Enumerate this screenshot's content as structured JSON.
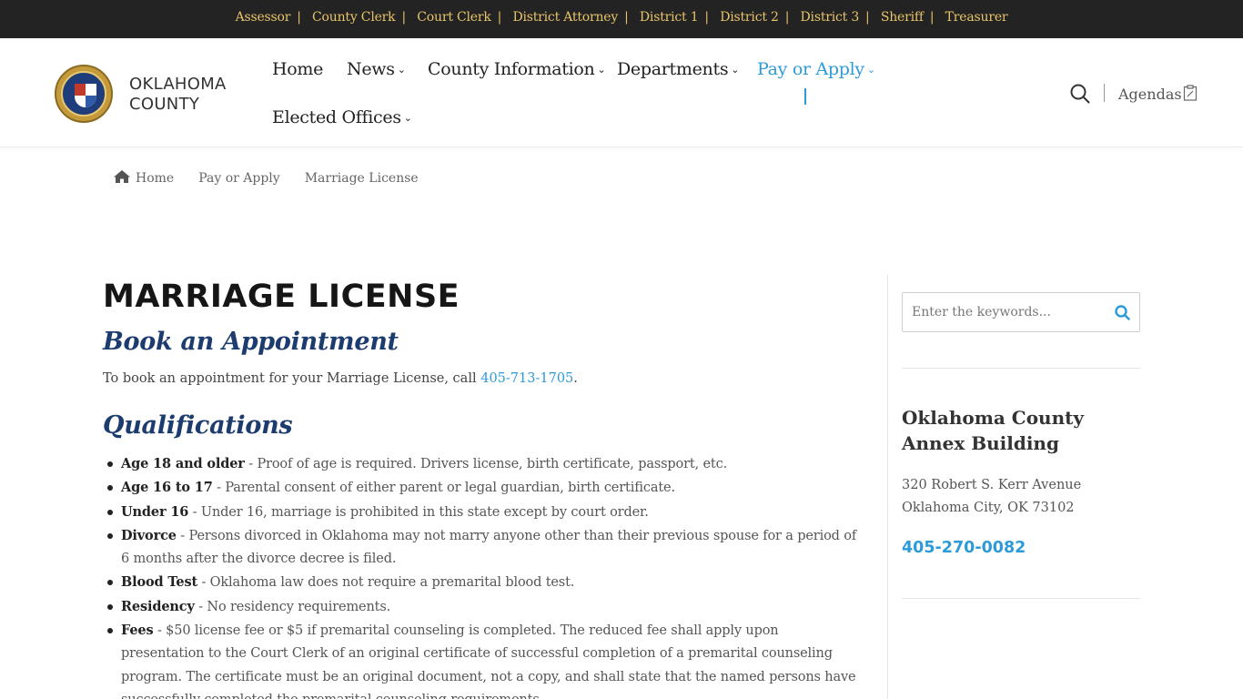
{
  "topbar": {
    "links": [
      "Assessor",
      "County Clerk",
      "Court Clerk",
      "District Attorney",
      "District 1",
      "District 2",
      "District 3",
      "Sheriff",
      "Treasurer"
    ],
    "separator": "|"
  },
  "logo": {
    "line1": "OKLAHOMA",
    "line2": "COUNTY"
  },
  "nav": {
    "home": "Home",
    "news": "News",
    "county_information": "County Information",
    "departments": "Departments",
    "pay_or_apply": "Pay or Apply",
    "elected_offices": "Elected Offices",
    "chevron": "⌄"
  },
  "header": {
    "agendas": "Agendas"
  },
  "breadcrumb": {
    "home": "Home",
    "pay_or_apply": "Pay or Apply",
    "current": "Marriage License"
  },
  "main": {
    "title": "MARRIAGE LICENSE",
    "book_heading": "Book an Appointment",
    "book_text_before": "To book an appointment for your Marriage License, call ",
    "book_phone": "405-713-1705",
    "book_text_after": ".",
    "qual_heading": "Qualifications",
    "qualifications": [
      {
        "term": "Age 18 and older",
        "text": " - Proof of age is required. Drivers license, birth certificate, passport, etc."
      },
      {
        "term": "Age 16 to 17",
        "text": " - Parental consent of either parent or legal guardian, birth certificate."
      },
      {
        "term": "Under 16",
        "text": " - Under 16, marriage is prohibited in this state except by court order."
      },
      {
        "term": "Divorce",
        "text": " - Persons divorced in Oklahoma may not marry anyone other than their previous spouse for a period of 6 months after the divorce decree is filed."
      },
      {
        "term": "Blood Test",
        "text": " - Oklahoma law does not require a premarital blood test."
      },
      {
        "term": "Residency",
        "text": " - No residency requirements."
      },
      {
        "term": "Fees",
        "text": " - $50 license fee or $5 if premarital counseling is completed. The reduced fee shall apply upon presentation to the Court Clerk of an original certificate of successful completion of a premarital counseling program. The certificate must be an original document, not a copy, and shall state that the named persons have successfully completed the premarital counseling requirements."
      }
    ]
  },
  "sidebar": {
    "search_placeholder": "Enter the keywords...",
    "annex_title": "Oklahoma County Annex Building",
    "address_line1": "320 Robert S. Kerr Avenue",
    "address_line2": "Oklahoma City, OK 73102",
    "phone": "405-270-0082"
  },
  "colors": {
    "topbar_bg": "#232323",
    "topbar_link": "#e8c46a",
    "accent": "#2d9bd8",
    "heading_blue": "#1c3b6e"
  }
}
